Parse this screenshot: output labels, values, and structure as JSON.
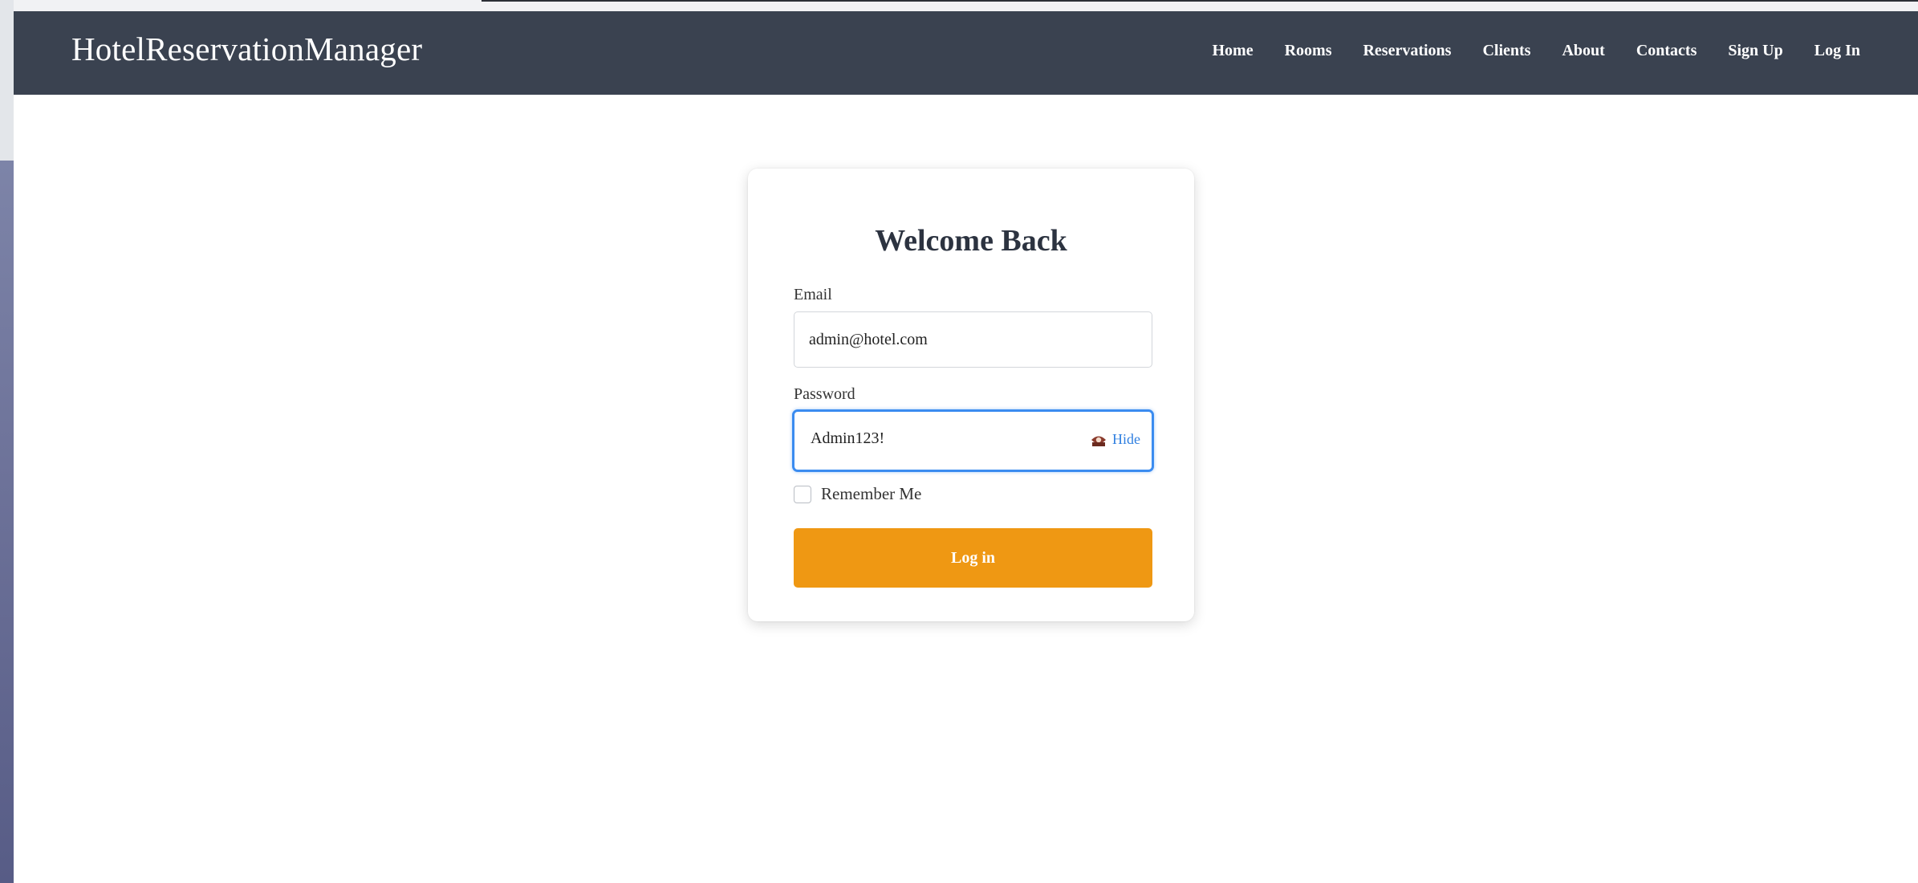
{
  "brand": "HotelReservationManager",
  "nav": {
    "items": [
      {
        "label": "Home"
      },
      {
        "label": "Rooms"
      },
      {
        "label": "Reservations"
      },
      {
        "label": "Clients"
      },
      {
        "label": "About"
      },
      {
        "label": "Contacts"
      },
      {
        "label": "Sign Up"
      },
      {
        "label": "Log In"
      }
    ]
  },
  "login": {
    "title": "Welcome Back",
    "email_label": "Email",
    "email_value": "admin@hotel.com",
    "password_label": "Password",
    "password_value": "Admin123!",
    "toggle_icon": "hidden-eye-icon",
    "toggle_label": "Hide",
    "remember_label": "Remember Me",
    "remember_checked": false,
    "submit_label": "Log in"
  },
  "colors": {
    "navbar": "#3a4250",
    "accent_button": "#ef9813",
    "focus_ring": "#3b8cf0",
    "link": "#2f7fe0"
  }
}
